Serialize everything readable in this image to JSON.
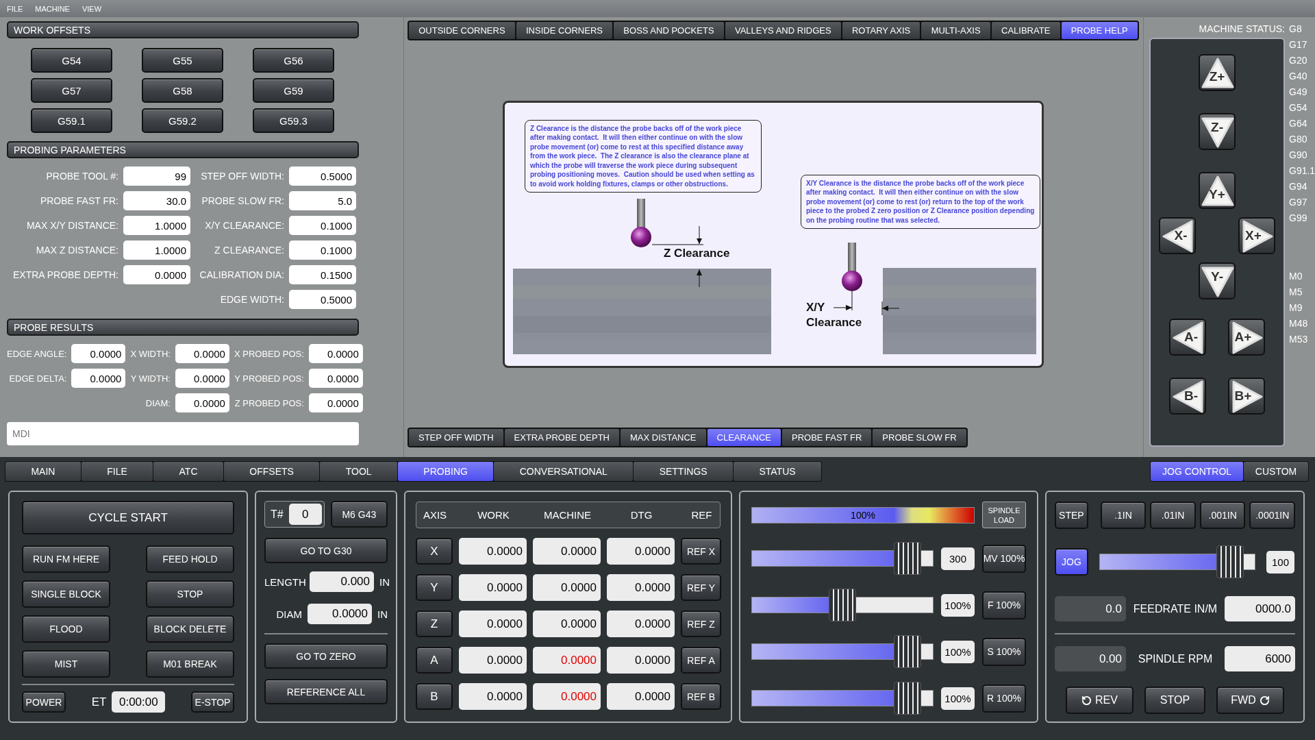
{
  "menu_bar": [
    "FILE",
    "MACHINE",
    "VIEW"
  ],
  "work_offsets": {
    "title": "WORK OFFSETS",
    "buttons": [
      "G54",
      "G55",
      "G56",
      "G57",
      "G58",
      "G59",
      "G59.1",
      "G59.2",
      "G59.3"
    ]
  },
  "probing_parameters": {
    "title": "PROBING PARAMETERS",
    "left_fields": [
      {
        "label": "PROBE TOOL #:",
        "value": "99"
      },
      {
        "label": "PROBE FAST FR:",
        "value": "30.0"
      },
      {
        "label": "MAX X/Y DISTANCE:",
        "value": "1.0000"
      },
      {
        "label": "MAX Z DISTANCE:",
        "value": "1.0000"
      },
      {
        "label": "EXTRA PROBE DEPTH:",
        "value": "0.0000"
      }
    ],
    "right_fields": [
      {
        "label": "STEP OFF WIDTH:",
        "value": "0.5000"
      },
      {
        "label": "PROBE SLOW FR:",
        "value": "5.0"
      },
      {
        "label": "X/Y CLEARANCE:",
        "value": "0.1000"
      },
      {
        "label": "Z CLEARANCE:",
        "value": "0.1000"
      },
      {
        "label": "CALIBRATION DIA:",
        "value": "0.1500"
      },
      {
        "label": "EDGE WIDTH:",
        "value": "0.5000"
      }
    ]
  },
  "probe_results": {
    "title": "PROBE RESULTS",
    "columns": [
      [
        {
          "label": "EDGE ANGLE:",
          "value": "0.0000"
        },
        {
          "label": "EDGE DELTA:",
          "value": "0.0000"
        }
      ],
      [
        {
          "label": "X WIDTH:",
          "value": "0.0000"
        },
        {
          "label": "Y WIDTH:",
          "value": "0.0000"
        },
        {
          "label": "DIAM:",
          "value": "0.0000"
        }
      ],
      [
        {
          "label": "X PROBED POS:",
          "value": "0.0000"
        },
        {
          "label": "Y PROBED POS:",
          "value": "0.0000"
        },
        {
          "label": "Z PROBED POS:",
          "value": "0.0000"
        }
      ]
    ]
  },
  "mdi": {
    "placeholder": "MDI"
  },
  "probe_tabs": [
    {
      "label": "OUTSIDE CORNERS",
      "selected": false
    },
    {
      "label": "INSIDE CORNERS",
      "selected": false
    },
    {
      "label": "BOSS AND POCKETS",
      "selected": false
    },
    {
      "label": "VALLEYS AND RIDGES",
      "selected": false
    },
    {
      "label": "ROTARY AXIS",
      "selected": false
    },
    {
      "label": "MULTI-AXIS",
      "selected": false
    },
    {
      "label": "CALIBRATE",
      "selected": false
    },
    {
      "label": "PROBE HELP",
      "selected": true
    }
  ],
  "help": {
    "z_note": "Z Clearance is the distance the probe backs off of the work piece after making contact.  It will then either continue on with the slow probe movement (or) come to rest at this specified distance away from the work piece.  The Z clearance is also the clearance plane at which the probe will traverse the work piece during subsequent probing positioning moves.  Caution should be used when setting as to avoid work holding fixtures, clamps or other obstructions.",
    "xy_note": "X/Y Clearance is the distance the probe backs off of the work piece after making contact.  It will then either continue on with the slow probe movement (or) come to rest (or) return to the top of the work piece to the probed Z zero position or Z Clearance position depending on the probing routine that was selected.",
    "z_label": "Z Clearance",
    "xy_label_top": "X/Y",
    "xy_label_bottom": "Clearance"
  },
  "help_tabs": [
    {
      "label": "STEP OFF WIDTH",
      "selected": false
    },
    {
      "label": "EXTRA PROBE DEPTH",
      "selected": false
    },
    {
      "label": "MAX DISTANCE",
      "selected": false
    },
    {
      "label": "CLEARANCE",
      "selected": true
    },
    {
      "label": "PROBE FAST FR",
      "selected": false
    },
    {
      "label": "PROBE SLOW FR",
      "selected": false
    }
  ],
  "machine_status": {
    "label": "MACHINE STATUS:",
    "g_codes": [
      "G8",
      "G17",
      "G20",
      "G40",
      "G49",
      "G54",
      "G64",
      "G80",
      "G90",
      "G91.1",
      "G94",
      "G97",
      "G99"
    ],
    "m_codes": [
      "M0",
      "M5",
      "M9",
      "M48",
      "M53"
    ]
  },
  "jog_buttons": [
    [
      {
        "label": "Z+",
        "kind": "up"
      }
    ],
    [
      {
        "label": "Z-",
        "kind": "down"
      }
    ],
    [
      {
        "label": "Y+",
        "kind": "up"
      }
    ],
    [
      {
        "label": "X-",
        "kind": "left"
      },
      {
        "label": "X+",
        "kind": "right"
      }
    ],
    [
      {
        "label": "Y-",
        "kind": "down"
      }
    ],
    [
      {
        "label": "A-",
        "kind": "left"
      },
      {
        "label": "A+",
        "kind": "right"
      }
    ],
    [
      {
        "label": "B-",
        "kind": "left"
      },
      {
        "label": "B+",
        "kind": "right"
      }
    ]
  ],
  "main_tabs": [
    {
      "label": "MAIN",
      "selected": false
    },
    {
      "label": "FILE",
      "selected": false
    },
    {
      "label": "ATC",
      "selected": false
    },
    {
      "label": "OFFSETS",
      "selected": false
    },
    {
      "label": "TOOL",
      "selected": false
    },
    {
      "label": "PROBING",
      "selected": true
    },
    {
      "label": "CONVERSATIONAL",
      "selected": false
    },
    {
      "label": "SETTINGS",
      "selected": false
    },
    {
      "label": "STATUS",
      "selected": false
    }
  ],
  "side_tabs": [
    {
      "label": "JOG CONTROL",
      "selected": true
    },
    {
      "label": "CUSTOM",
      "selected": false
    }
  ],
  "program": {
    "cycle_start": "CYCLE START",
    "buttons": [
      "RUN FM HERE",
      "FEED HOLD",
      "SINGLE BLOCK",
      "STOP",
      "FLOOD",
      "BLOCK DELETE",
      "MIST",
      "M01 BREAK"
    ],
    "power": "POWER",
    "et_label": "ET",
    "et_value": "0:00:00",
    "estop": "E-STOP"
  },
  "tool": {
    "t_label": "T#",
    "t_value": "0",
    "m6": "M6 G43",
    "go_g30": "GO TO G30",
    "length_label": "LENGTH",
    "length_value": "0.000",
    "length_unit": "IN",
    "diam_label": "DIAM",
    "diam_value": "0.0000",
    "diam_unit": "IN",
    "go_zero": "GO TO ZERO",
    "reference_all": "REFERENCE ALL"
  },
  "dro": {
    "columns": [
      "AXIS",
      "WORK",
      "MACHINE",
      "DTG",
      "REF"
    ],
    "rows": [
      {
        "axis": "X",
        "work": "0.0000",
        "machine": "0.0000",
        "dtg": "0.0000",
        "ref": "REF X",
        "machine_alert": false
      },
      {
        "axis": "Y",
        "work": "0.0000",
        "machine": "0.0000",
        "dtg": "0.0000",
        "ref": "REF Y",
        "machine_alert": false
      },
      {
        "axis": "Z",
        "work": "0.0000",
        "machine": "0.0000",
        "dtg": "0.0000",
        "ref": "REF Z",
        "machine_alert": false
      },
      {
        "axis": "A",
        "work": "0.0000",
        "machine": "0.0000",
        "dtg": "0.0000",
        "ref": "REF A",
        "machine_alert": true
      },
      {
        "axis": "B",
        "work": "0.0000",
        "machine": "0.0000",
        "dtg": "0.0000",
        "ref": "REF B",
        "machine_alert": true
      }
    ]
  },
  "overrides": {
    "spindle_load": {
      "reading": "100%",
      "level": 1,
      "label": "SPINDLE LOAD"
    },
    "sliders": [
      {
        "level": 0.92,
        "reading": "300",
        "button": "MV 100%"
      },
      {
        "level": 0.5,
        "reading": "100%",
        "button": "F 100%"
      },
      {
        "level": 0.92,
        "reading": "100%",
        "button": "S 100%"
      },
      {
        "level": 0.92,
        "reading": "100%",
        "button": "R 100%"
      }
    ]
  },
  "jog": {
    "step": "STEP",
    "increments": [
      {
        "label": ".1IN",
        "selected": false
      },
      {
        "label": ".01IN",
        "selected": false
      },
      {
        "label": ".001IN",
        "selected": false
      },
      {
        "label": ".0001IN",
        "selected": false
      }
    ],
    "jog_mode": {
      "label": "JOG",
      "on": true
    },
    "slider": {
      "level": 0.91,
      "reading": "100"
    },
    "feedrate": {
      "actual": "0.0",
      "label": "FEEDRATE IN/M",
      "value": "0000.0"
    },
    "spindle": {
      "actual": "0.00",
      "label": "SPINDLE RPM",
      "value": "6000"
    },
    "buttons": [
      {
        "label": "REV",
        "kind": "rev"
      },
      {
        "label": "STOP",
        "kind": "stop"
      },
      {
        "label": "FWD",
        "kind": "fwd"
      }
    ]
  }
}
